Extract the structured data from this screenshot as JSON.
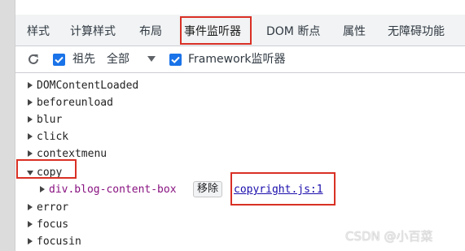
{
  "tabs": [
    {
      "label": "样式"
    },
    {
      "label": "计算样式"
    },
    {
      "label": "布局"
    },
    {
      "label": "事件监听器",
      "active": true
    },
    {
      "label": "DOM 断点"
    },
    {
      "label": "属性"
    },
    {
      "label": "无障碍功能"
    }
  ],
  "toolbar": {
    "refresh_icon": "refresh-icon",
    "ancestors_label": "祖先",
    "ancestors_checked": true,
    "filter_value": "全部",
    "framework_label": "Framework监听器",
    "framework_checked": true
  },
  "events": [
    {
      "name": "DOMContentLoaded",
      "expanded": false
    },
    {
      "name": "beforeunload",
      "expanded": false
    },
    {
      "name": "blur",
      "expanded": false
    },
    {
      "name": "click",
      "expanded": false
    },
    {
      "name": "contextmenu",
      "expanded": false
    },
    {
      "name": "copy",
      "expanded": true
    },
    {
      "name": "error",
      "expanded": false
    },
    {
      "name": "focus",
      "expanded": false
    },
    {
      "name": "focusin",
      "expanded": false
    }
  ],
  "copy_listener": {
    "node": "div.blog-content-box",
    "remove_label": "移除",
    "source_link": "copyright.js:1"
  },
  "watermark": "CSDN @小百菜",
  "colors": {
    "accent": "#1a73e8",
    "highlight_box": "#d93025",
    "node": "#881280",
    "link": "#1a0dab"
  }
}
